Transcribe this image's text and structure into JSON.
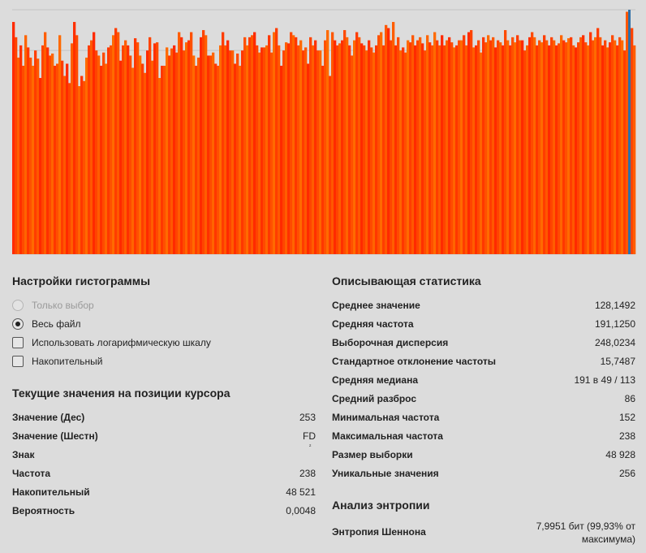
{
  "chart_data": {
    "type": "bar",
    "title": "",
    "x_range": [
      0,
      255
    ],
    "ylim": [
      0,
      240
    ],
    "grid": true,
    "bar_color_gradient": [
      "#ff2a00",
      "#ff6a00"
    ],
    "cursor_color": "#2f6fa8",
    "cursor_value": 253,
    "values": [
      228,
      213,
      193,
      205,
      185,
      215,
      203,
      193,
      185,
      200,
      192,
      173,
      205,
      218,
      203,
      195,
      197,
      185,
      187,
      215,
      190,
      175,
      187,
      168,
      207,
      228,
      215,
      165,
      175,
      170,
      193,
      205,
      210,
      218,
      200,
      195,
      185,
      198,
      187,
      203,
      205,
      215,
      222,
      218,
      190,
      205,
      210,
      205,
      195,
      183,
      212,
      208,
      195,
      187,
      178,
      200,
      213,
      190,
      207,
      208,
      173,
      185,
      185,
      203,
      195,
      202,
      205,
      198,
      218,
      213,
      200,
      208,
      210,
      218,
      195,
      185,
      193,
      213,
      220,
      215,
      195,
      195,
      198,
      187,
      185,
      205,
      218,
      205,
      210,
      200,
      200,
      187,
      197,
      185,
      200,
      213,
      205,
      213,
      215,
      218,
      205,
      198,
      203,
      203,
      205,
      215,
      198,
      218,
      222,
      205,
      185,
      200,
      208,
      207,
      218,
      215,
      213,
      205,
      210,
      200,
      203,
      187,
      213,
      205,
      210,
      200,
      200,
      185,
      210,
      220,
      175,
      218,
      210,
      205,
      207,
      210,
      220,
      213,
      205,
      195,
      210,
      218,
      213,
      207,
      205,
      200,
      210,
      203,
      198,
      205,
      215,
      218,
      205,
      225,
      222,
      210,
      228,
      205,
      213,
      200,
      203,
      198,
      210,
      208,
      215,
      205,
      210,
      213,
      207,
      200,
      215,
      208,
      205,
      218,
      210,
      205,
      215,
      205,
      210,
      213,
      208,
      203,
      205,
      210,
      210,
      215,
      205,
      218,
      220,
      203,
      205,
      210,
      198,
      213,
      208,
      215,
      210,
      213,
      203,
      210,
      208,
      205,
      220,
      210,
      205,
      213,
      208,
      215,
      210,
      210,
      200,
      205,
      213,
      218,
      213,
      205,
      210,
      208,
      215,
      210,
      205,
      213,
      210,
      205,
      207,
      215,
      210,
      208,
      212,
      213,
      205,
      203,
      208,
      213,
      215,
      208,
      205,
      218,
      210,
      213,
      222,
      213,
      205,
      210,
      203,
      208,
      215,
      210,
      205,
      213,
      210,
      200,
      238,
      213,
      222,
      205
    ]
  },
  "histogram_settings": {
    "title": "Настройки гистограммы",
    "options": [
      {
        "label": "Только выбор",
        "type": "radio",
        "checked": false,
        "disabled": true
      },
      {
        "label": "Весь файл",
        "type": "radio",
        "checked": true,
        "disabled": false
      },
      {
        "label": "Использовать логарифмическую шкалу",
        "type": "checkbox",
        "checked": false,
        "disabled": false
      },
      {
        "label": "Накопительный",
        "type": "checkbox",
        "checked": false,
        "disabled": false
      }
    ]
  },
  "cursor_values": {
    "title": "Текущие значения на позиции курсора",
    "rows": [
      {
        "label": "Значение (Дес)",
        "value": "253"
      },
      {
        "label": "Значение (Шестн)",
        "value": "FD"
      },
      {
        "label": "Знак",
        "value": ""
      },
      {
        "label": "Частота",
        "value": "238"
      },
      {
        "label": "Накопительный",
        "value": "48 521"
      },
      {
        "label": "Вероятность",
        "value": "0,0048"
      }
    ],
    "sign_glyph": "²"
  },
  "descriptive_stats": {
    "title": "Описывающая статистика",
    "rows": [
      {
        "label": "Среднее значение",
        "value": "128,1492"
      },
      {
        "label": "Средняя частота",
        "value": "191,1250"
      },
      {
        "label": "Выборочная дисперсия",
        "value": "248,0234"
      },
      {
        "label": "Стандартное отклонение частоты",
        "value": "15,7487"
      },
      {
        "label": "Средняя медиана",
        "value": "191 в 49 / 113"
      },
      {
        "label": "Средний разброс",
        "value": "86"
      },
      {
        "label": "Минимальная частота",
        "value": "152"
      },
      {
        "label": "Максимальная частота",
        "value": "238"
      },
      {
        "label": "Размер выборки",
        "value": "48 928"
      },
      {
        "label": "Уникальные значения",
        "value": "256"
      }
    ]
  },
  "entropy": {
    "title": "Анализ энтропии",
    "label": "Энтропия Шеннона",
    "value": "7,9951 бит (99,93% от максимума)"
  }
}
